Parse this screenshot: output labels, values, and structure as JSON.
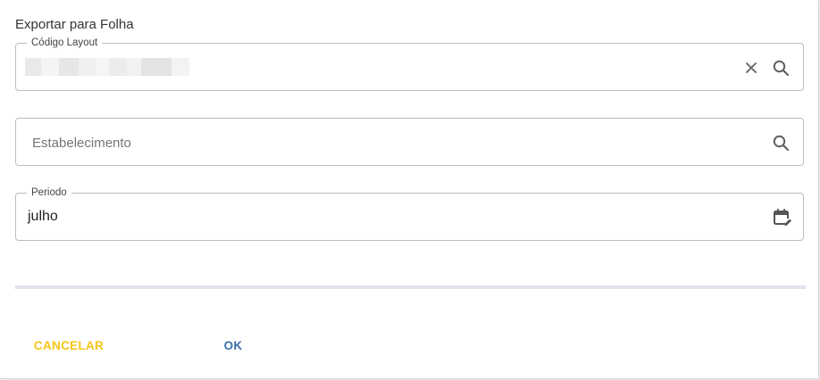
{
  "dialog": {
    "title": "Exportar para Folha"
  },
  "fields": {
    "layout_code": {
      "label": "Código Layout",
      "value_redacted": true,
      "clear_icon": "close-icon",
      "search_icon": "search-icon"
    },
    "establishment": {
      "placeholder": "Estabelecimento",
      "search_icon": "search-icon"
    },
    "period": {
      "label": "Periodo",
      "value": "julho",
      "calendar_icon": "calendar-edit-icon"
    }
  },
  "progress": {
    "color": "#dfe3ed"
  },
  "actions": {
    "cancel_label": "CANCELAR",
    "cancel_color": "#f5c518",
    "ok_label": "OK",
    "ok_color": "#3d6fa8"
  }
}
